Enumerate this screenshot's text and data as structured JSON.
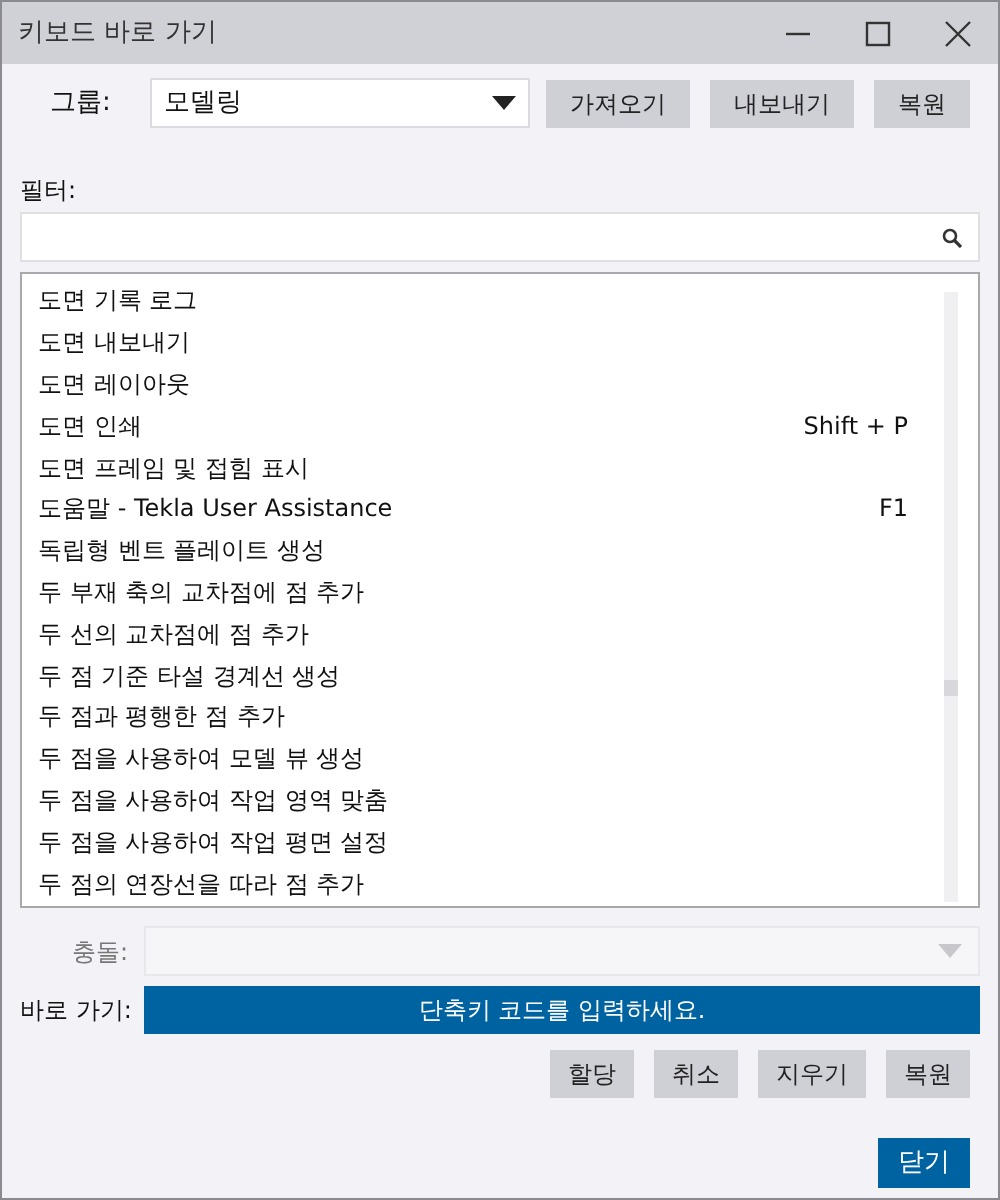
{
  "window": {
    "title": "키보드 바로 가기"
  },
  "group": {
    "label": "그룹:",
    "value": "모델링",
    "buttons": [
      "가져오기",
      "내보내기",
      "복원"
    ]
  },
  "filter": {
    "label": "필터:"
  },
  "commands": [
    {
      "name": "도면 기록 로그"
    },
    {
      "name": "도면 내보내기"
    },
    {
      "name": "도면 레이아웃"
    },
    {
      "name": "도면 인쇄",
      "shortcut": "Shift + P"
    },
    {
      "name": "도면 프레임 및 접힘 표시"
    },
    {
      "name": "도움말 - Tekla User Assistance",
      "shortcut": "F1"
    },
    {
      "name": "독립형 벤트 플레이트 생성"
    },
    {
      "name": "두 부재 축의 교차점에 점 추가"
    },
    {
      "name": "두 선의 교차점에 점 추가"
    },
    {
      "name": "두 점 기준 타설 경계선 생성"
    },
    {
      "name": "두 점과 평행한 점 추가"
    },
    {
      "name": "두 점을 사용하여 모델 뷰 생성"
    },
    {
      "name": "두 점을 사용하여 작업 영역 맞춤"
    },
    {
      "name": "두 점을 사용하여 작업 평면 설정"
    },
    {
      "name": "두 점의 연장선을 따라 점 추가"
    }
  ],
  "conflict": {
    "label": "충돌:",
    "disabled": true
  },
  "shortcut": {
    "label": "바로 가기:",
    "prompt": "단축키 코드를 입력하세요."
  },
  "shortcut_buttons": [
    "할당",
    "취소",
    "지우기",
    "복원"
  ],
  "close_button": "닫기"
}
